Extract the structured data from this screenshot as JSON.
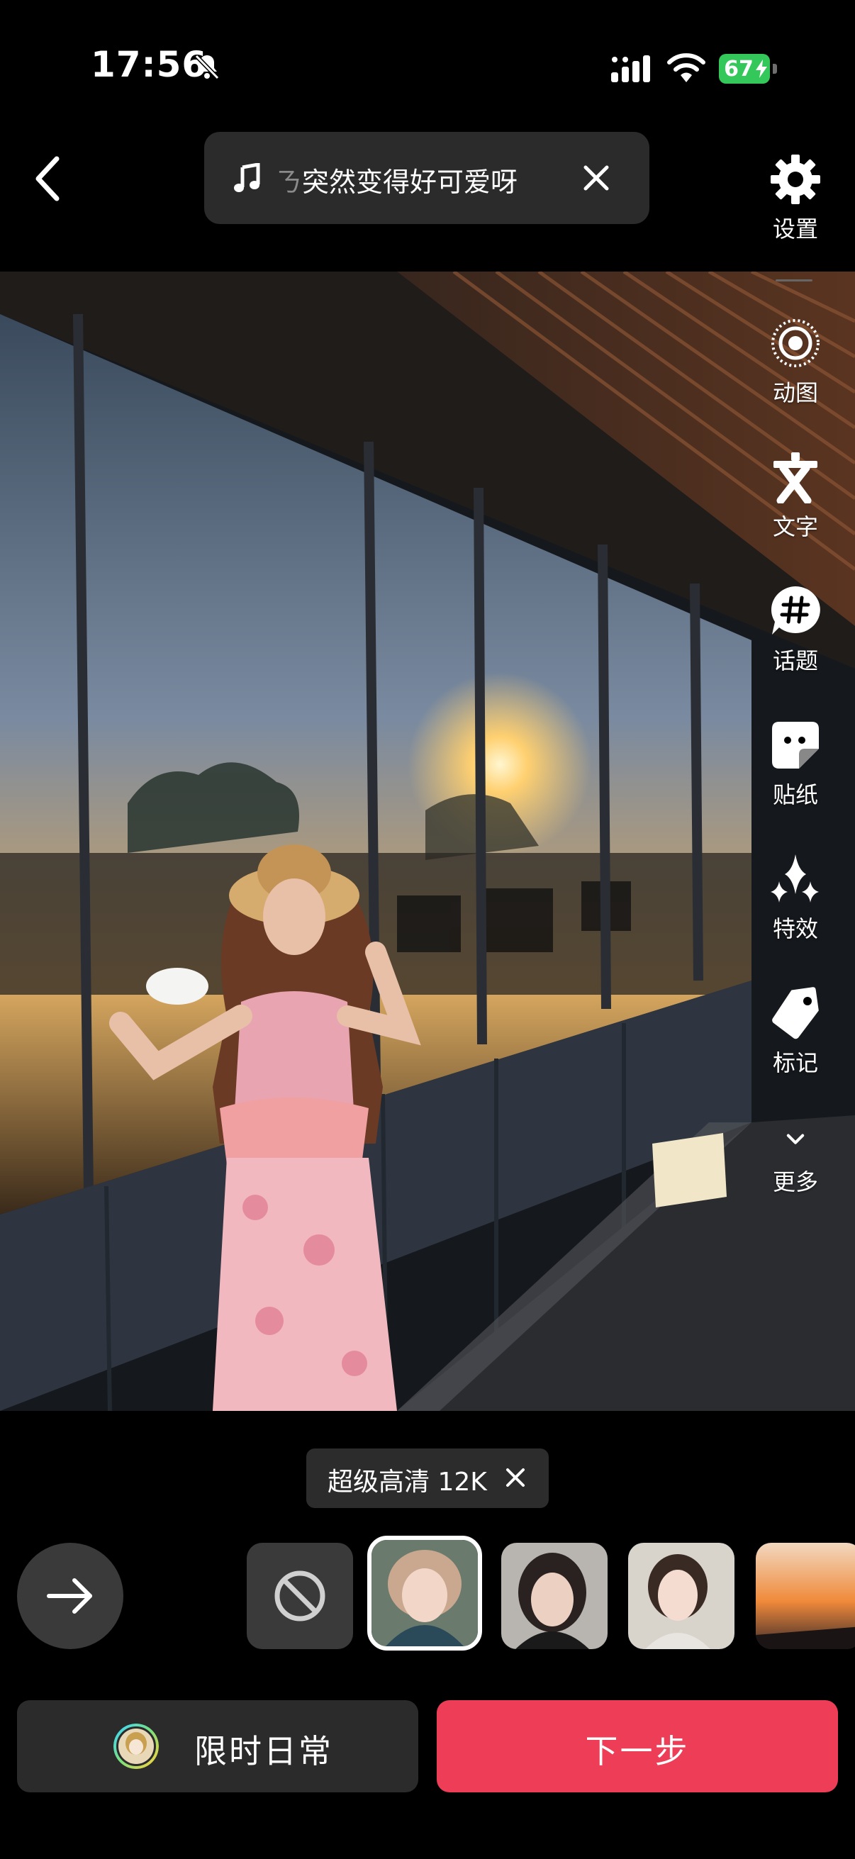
{
  "status_bar": {
    "time": "17:56",
    "battery": "67",
    "icons": [
      "bell-slash-icon",
      "signal-icon",
      "wifi-icon",
      "battery-charging-icon"
    ]
  },
  "header": {
    "back_icon": "chevron-left-icon",
    "music": {
      "icon": "music-note-icon",
      "title_faded": "ㄋ",
      "title": "突然变得好可爱呀",
      "close_icon": "close-icon"
    }
  },
  "tools": [
    {
      "label": "设置",
      "icon": "gear-icon"
    },
    {
      "label": "动图",
      "icon": "live-photo-icon"
    },
    {
      "label": "文字",
      "icon": "text-icon"
    },
    {
      "label": "话题",
      "icon": "hashtag-icon"
    },
    {
      "label": "贴纸",
      "icon": "sticker-icon"
    },
    {
      "label": "特效",
      "icon": "sparkle-icon"
    },
    {
      "label": "标记",
      "icon": "tag-icon"
    },
    {
      "label": "更多",
      "icon": "chevron-down-icon"
    }
  ],
  "quality_chip": {
    "label": "超级高清 12K"
  },
  "filters": {
    "none_icon": "prohibited-icon",
    "selected_index": 0
  },
  "bottom": {
    "feature_label": "限时日常",
    "next_label": "下一步"
  },
  "colors": {
    "accent": "#ee3e57",
    "battery": "#34c759",
    "surface": "#2b2b2b"
  }
}
